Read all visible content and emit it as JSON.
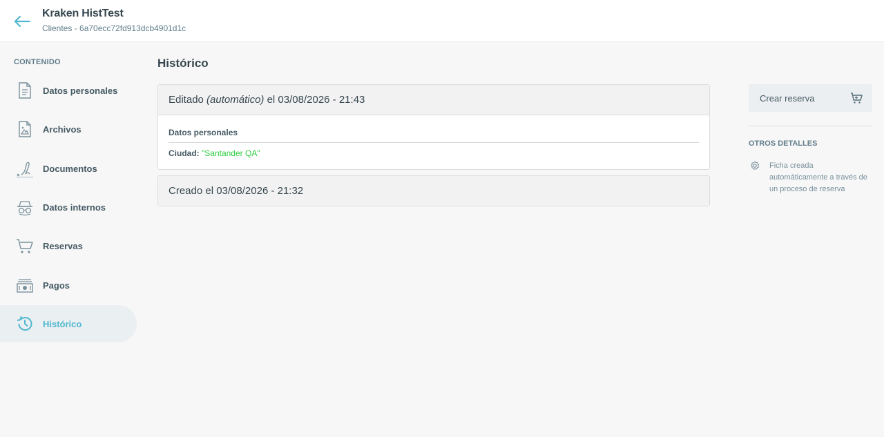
{
  "header": {
    "title": "Kraken HistTest",
    "subtitle": "Clientes - 6a70ecc72fd913dcb4901d1c"
  },
  "sidebar": {
    "section_label": "CONTENIDO",
    "items": [
      {
        "label": "Datos personales",
        "icon": "document-icon"
      },
      {
        "label": "Archivos",
        "icon": "image-file-icon"
      },
      {
        "label": "Documentos",
        "icon": "signature-icon"
      },
      {
        "label": "Datos internos",
        "icon": "incognito-icon"
      },
      {
        "label": "Reservas",
        "icon": "cart-icon"
      },
      {
        "label": "Pagos",
        "icon": "cash-icon"
      },
      {
        "label": "Histórico",
        "icon": "history-icon",
        "active": true
      }
    ]
  },
  "main": {
    "title": "Histórico",
    "entries": [
      {
        "prefix": "Editado",
        "qualifier": "(automático)",
        "suffix": "el 03/08/2026 - 21:43",
        "group": "Datos personales",
        "change_key": "Ciudad:",
        "change_value": "\"Santander QA\""
      },
      {
        "text": "Creado el 03/08/2026 - 21:32"
      }
    ]
  },
  "right_panel": {
    "create_label": "Crear reserva",
    "other_label": "OTROS DETALLES",
    "detail_text": "Ficha creada automáticamente a través de un proceso de reserva"
  },
  "colors": {
    "accent": "#4fb8cf",
    "added_value": "#2ecc40",
    "text_dark": "#37474f"
  }
}
